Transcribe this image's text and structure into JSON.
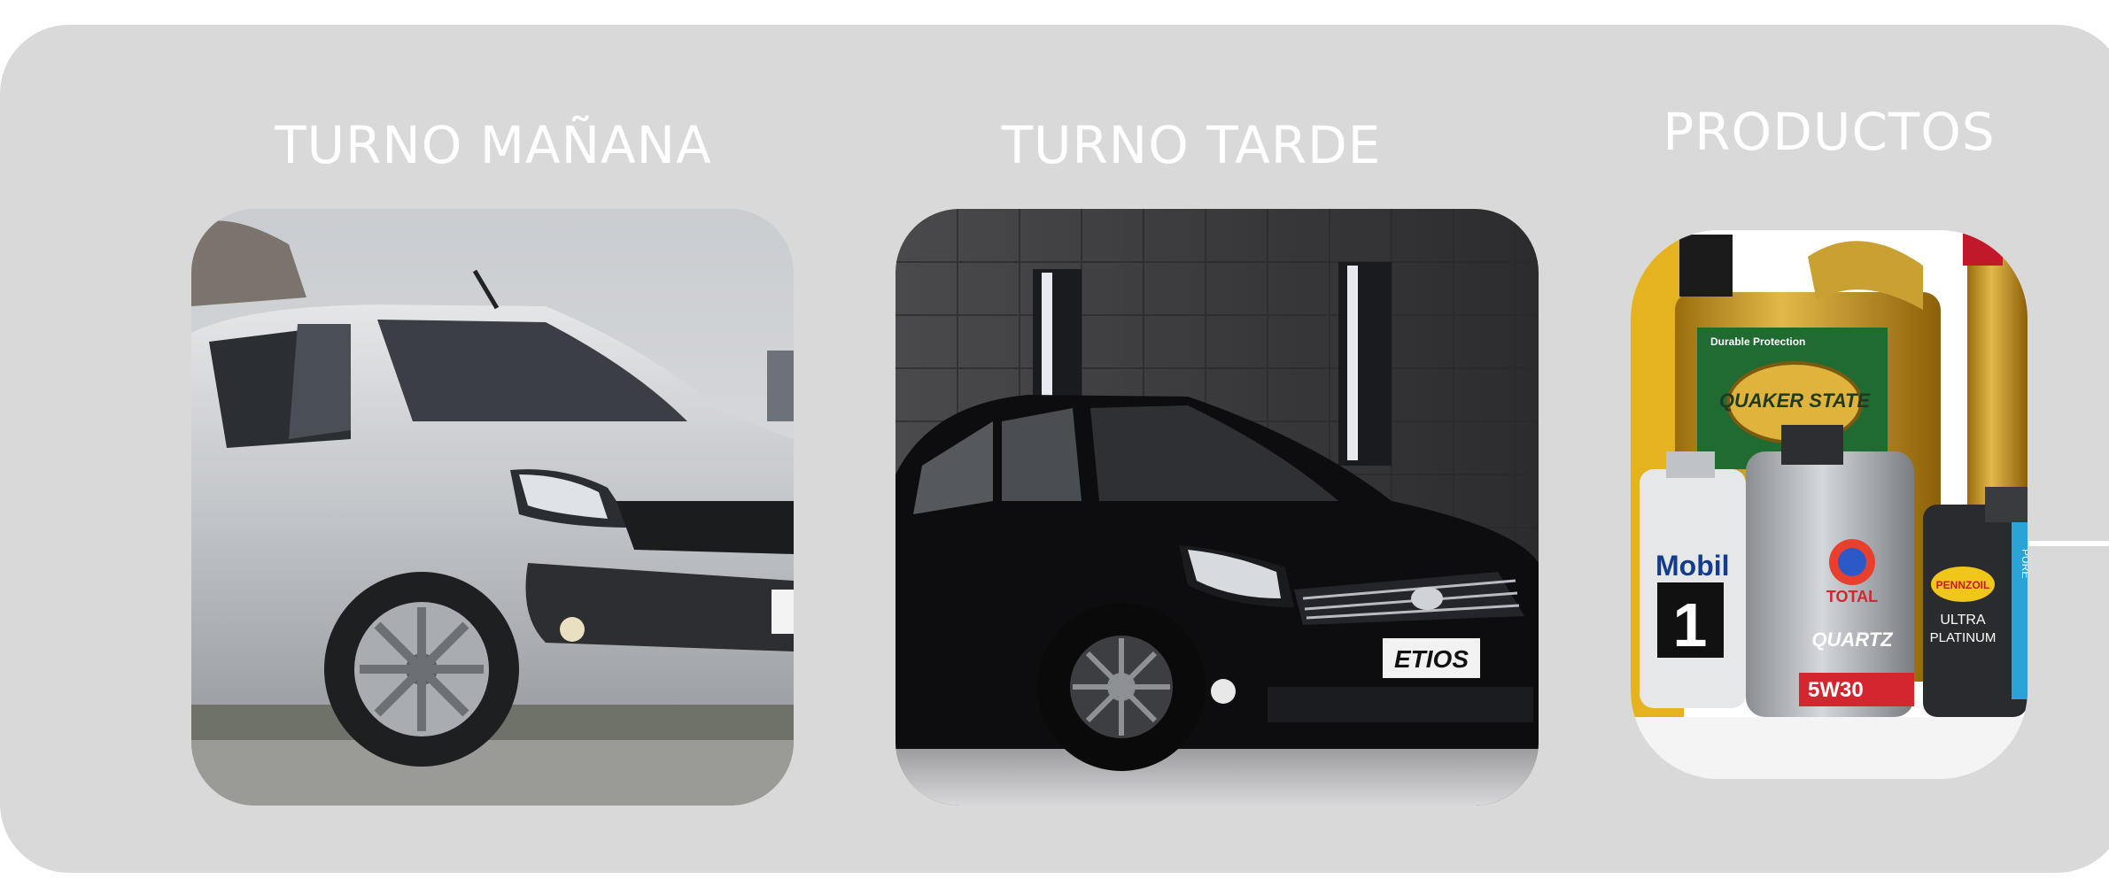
{
  "sections": {
    "morning": {
      "title": "TURNO MAÑANA",
      "image_alt": "Silver Toyota Etios hatchback"
    },
    "afternoon": {
      "title": "TURNO TARDE",
      "image_alt": "Black Toyota Etios hatchback",
      "plate_text": "ETIOS"
    },
    "products": {
      "title": "PRODUCTOS",
      "image_alt": "Motor oil bottles",
      "labels": {
        "quaker": "QUAKER STATE",
        "quaker_tag": "Durable Protection",
        "mobil": "Mobil",
        "mobil_num": "1",
        "total": "TOTAL",
        "quartz": "QUARTZ",
        "grade": "5W30",
        "pennzoil": "PENNZOIL",
        "ultra": "ULTRA",
        "platinum": "PLATINUM",
        "pure": "PURE"
      }
    }
  },
  "colors": {
    "panel": "#d9d9d9",
    "title": "#ffffff"
  }
}
